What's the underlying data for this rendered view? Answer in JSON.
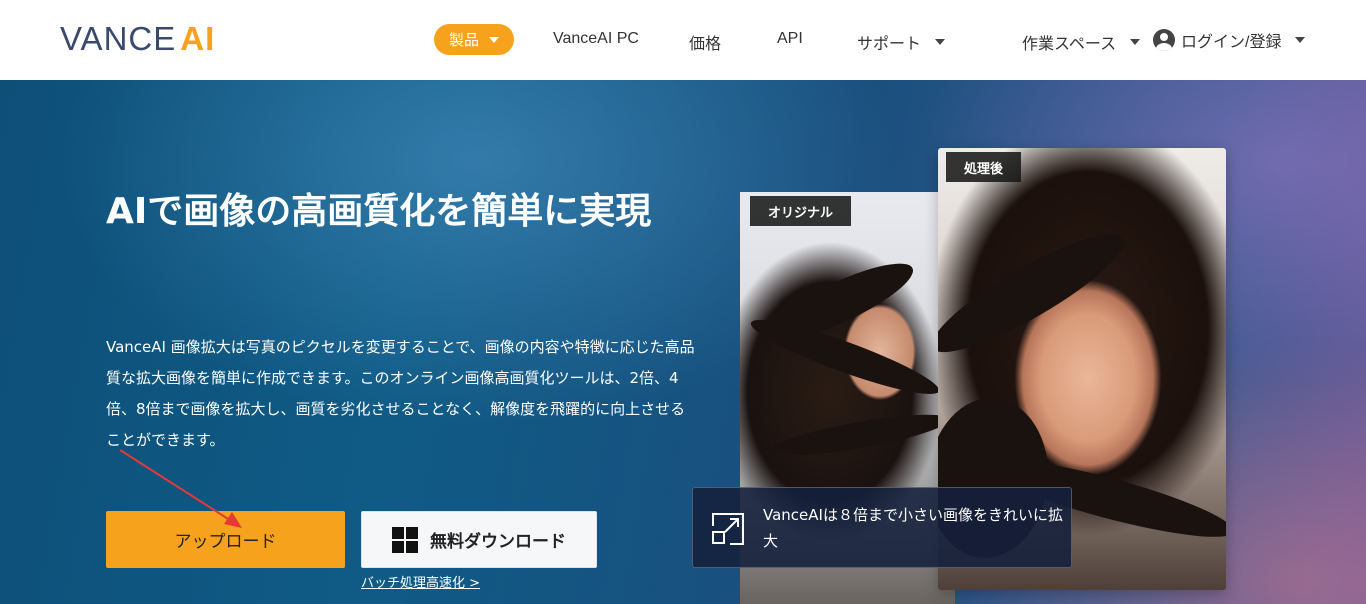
{
  "header": {
    "logo_main": "VANCE",
    "logo_accent": "AI",
    "nav": {
      "products": "製品",
      "pc": "VanceAI PC",
      "pricing": "価格",
      "api": "API",
      "support": "サポート",
      "workspace": "作業スペース",
      "login": "ログイン/登録"
    }
  },
  "hero": {
    "title": "AIで画像の高画質化を簡単に実現",
    "description": "VanceAI 画像拡大は写真のピクセルを変更することで、画像の内容や特徴に応じた高品質な拡大画像を簡単に作成できます。このオンライン画像高画質化ツールは、2倍、4倍、8倍まで画像を拡大し、画質を劣化させることなく、解像度を飛躍的に向上させることができます。",
    "upload_button": "アップロード",
    "download_button": "無料ダウンロード",
    "batch_link": "バッチ処理高速化 >"
  },
  "preview": {
    "original_label": "オリジナル",
    "processed_label": "処理後",
    "info_text": "VanceAIは８倍まで小さい画像をきれいに拡大"
  },
  "colors": {
    "accent": "#f7a21c",
    "hero_bg": "#0f5b86",
    "arrow": "#e53935"
  }
}
